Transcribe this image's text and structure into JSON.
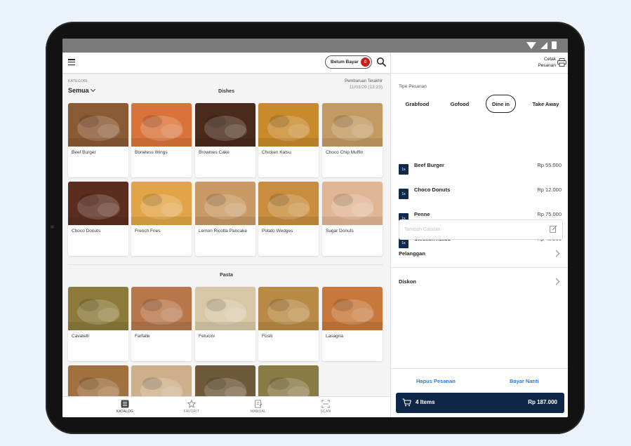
{
  "header": {
    "unpaid_label": "Belum Bayar",
    "unpaid_count": "0"
  },
  "category": {
    "label": "KATEGORI",
    "value": "Semua"
  },
  "last_update": {
    "label": "Pembaruan Terakhir",
    "time": "11/03/20 (13:23)"
  },
  "sections": [
    {
      "title": "Dishes",
      "items": [
        {
          "name": "Beef Burger",
          "color": "#8a5a34"
        },
        {
          "name": "Boneless Wings",
          "color": "#d9733a"
        },
        {
          "name": "Brownies Cake",
          "color": "#4a2a1a"
        },
        {
          "name": "Chicken Katsu",
          "color": "#c98a2c"
        },
        {
          "name": "Choco Chip Muffin",
          "color": "#c39a62"
        },
        {
          "name": "Choco Donuts",
          "color": "#5a2d1e"
        },
        {
          "name": "French Fries",
          "color": "#e2a447"
        },
        {
          "name": "Lemon Ricotta Pancake",
          "color": "#c99a63"
        },
        {
          "name": "Potato Wedges",
          "color": "#c88d3d"
        },
        {
          "name": "Sugar Donuts",
          "color": "#e1b695"
        }
      ]
    },
    {
      "title": "Pasta",
      "items": [
        {
          "name": "Cavatelli",
          "color": "#8d7a3a"
        },
        {
          "name": "Farfalle",
          "color": "#b7774a"
        },
        {
          "name": "Fetucini",
          "color": "#d8c7a7"
        },
        {
          "name": "Fusili",
          "color": "#b88a45"
        },
        {
          "name": "Lasagna",
          "color": "#c7783a"
        },
        {
          "name": "",
          "color": "#a0703e"
        },
        {
          "name": "",
          "color": "#cdb08a"
        },
        {
          "name": "",
          "color": "#6e5a3a"
        },
        {
          "name": "",
          "color": "#8a7b45"
        }
      ]
    }
  ],
  "bottom_nav": [
    {
      "label": "KATALOG",
      "icon": "catalog-icon",
      "active": true
    },
    {
      "label": "FAVORIT",
      "icon": "star-icon",
      "active": false
    },
    {
      "label": "MANUAL",
      "icon": "manual-icon",
      "active": false
    },
    {
      "label": "SCAN",
      "icon": "scan-icon",
      "active": false
    }
  ],
  "order": {
    "print_label": "Cetak Pesanan",
    "type_label": "Tipe Pesanan",
    "types": [
      "Grabfood",
      "Gofood",
      "Dine in",
      "Take Away"
    ],
    "selected_type": "Dine in",
    "items": [
      {
        "qty": "1x",
        "name": "Beef Burger",
        "price": "Rp 55.000"
      },
      {
        "qty": "1x",
        "name": "Choco Donuts",
        "price": "Rp 12.000"
      },
      {
        "qty": "1x",
        "name": "Penne",
        "price": "Rp 75.000"
      },
      {
        "qty": "1x",
        "name": "Chicken Katsu",
        "price": "Rp 45.000"
      }
    ],
    "note_placeholder": "Tambah Catatan",
    "customer_label": "Pelanggan",
    "discount_label": "Diskon",
    "delete_label": "Hapus Pesanan",
    "pay_later_label": "Bayar Nanti",
    "checkout_count": "4 Items",
    "checkout_total": "Rp 187.000",
    "accent_color": "#0f2747",
    "link_color": "#2a7bd8"
  }
}
